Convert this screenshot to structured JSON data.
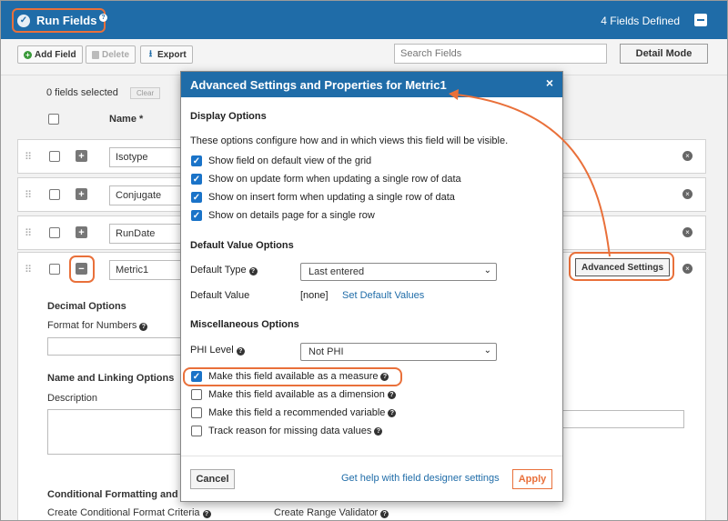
{
  "header": {
    "title": "Run Fields",
    "help": "?",
    "count": "4 Fields Defined"
  },
  "toolbar": {
    "add": "Add Field",
    "delete": "Delete",
    "export": "Export",
    "search_placeholder": "Search Fields",
    "detail_mode": "Detail Mode"
  },
  "list": {
    "selected": "0 fields selected",
    "clear": "Clear",
    "name_header": "Name *",
    "rows": [
      {
        "name": "Isotype"
      },
      {
        "name": "Conjugate"
      },
      {
        "name": "RunDate"
      },
      {
        "name": "Metric1"
      }
    ],
    "advanced_settings": "Advanced Settings",
    "decimal_options": "Decimal Options",
    "format_for_numbers": "Format for Numbers",
    "name_linking": "Name and Linking Options",
    "description": "Description",
    "conditional_formatting": "Conditional Formatting and V",
    "create_conditional": "Create Conditional Format Criteria",
    "create_range": "Create Range Validator"
  },
  "modal": {
    "title": "Advanced Settings and Properties for Metric1",
    "close": "×",
    "display_options": "Display Options",
    "display_desc": "These options configure how and in which views this field will be visible.",
    "display_checks": [
      {
        "label": "Show field on default view of the grid",
        "checked": true
      },
      {
        "label": "Show on update form when updating a single row of data",
        "checked": true
      },
      {
        "label": "Show on insert form when updating a single row of data",
        "checked": true
      },
      {
        "label": "Show on details page for a single row",
        "checked": true
      }
    ],
    "default_value_options": "Default Value Options",
    "default_type_label": "Default Type",
    "default_type_value": "Last entered",
    "default_value_label": "Default Value",
    "default_value_value": "[none]",
    "set_default_values": "Set Default Values",
    "misc_options": "Miscellaneous Options",
    "phi_label": "PHI Level",
    "phi_value": "Not PHI",
    "misc_checks": [
      {
        "label": "Make this field available as a measure",
        "checked": true
      },
      {
        "label": "Make this field available as a dimension",
        "checked": false
      },
      {
        "label": "Make this field a recommended variable",
        "checked": false
      },
      {
        "label": "Track reason for missing data values",
        "checked": false
      }
    ],
    "cancel": "Cancel",
    "help_link": "Get help with field designer settings",
    "apply": "Apply"
  },
  "colors": {
    "header_blue": "#1f6ca8",
    "highlight_orange": "#e9703a",
    "checkbox_blue": "#1a73c8"
  }
}
